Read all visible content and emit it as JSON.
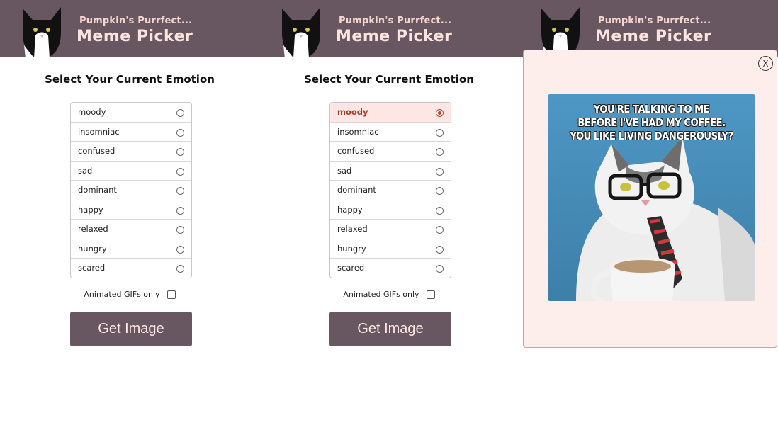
{
  "header": {
    "brand_small": "Pumpkin's Purrfect...",
    "brand_big": "Meme Picker"
  },
  "picker": {
    "heading": "Select Your Current Emotion",
    "emotions": [
      "moody",
      "insomniac",
      "confused",
      "sad",
      "dominant",
      "happy",
      "relaxed",
      "hungry",
      "scared"
    ],
    "gif_label": "Animated GIFs only",
    "button_label": "Get Image"
  },
  "panels": [
    {
      "selected_emotion": ""
    },
    {
      "selected_emotion": "moody"
    }
  ],
  "modal": {
    "close_label": "X",
    "meme_caption_lines": [
      "YOU'RE TALKING TO ME",
      "BEFORE I'VE HAD MY COFFEE.",
      "YOU LIKE LIVING DANGEROUSLY?"
    ]
  },
  "colors": {
    "header_bg": "#685760",
    "accent": "#c23b22",
    "selected_row_bg": "#fde7e4",
    "modal_bg": "#fdeeec"
  },
  "icons": {
    "logo": "cat-logo-icon",
    "close": "close-icon"
  }
}
